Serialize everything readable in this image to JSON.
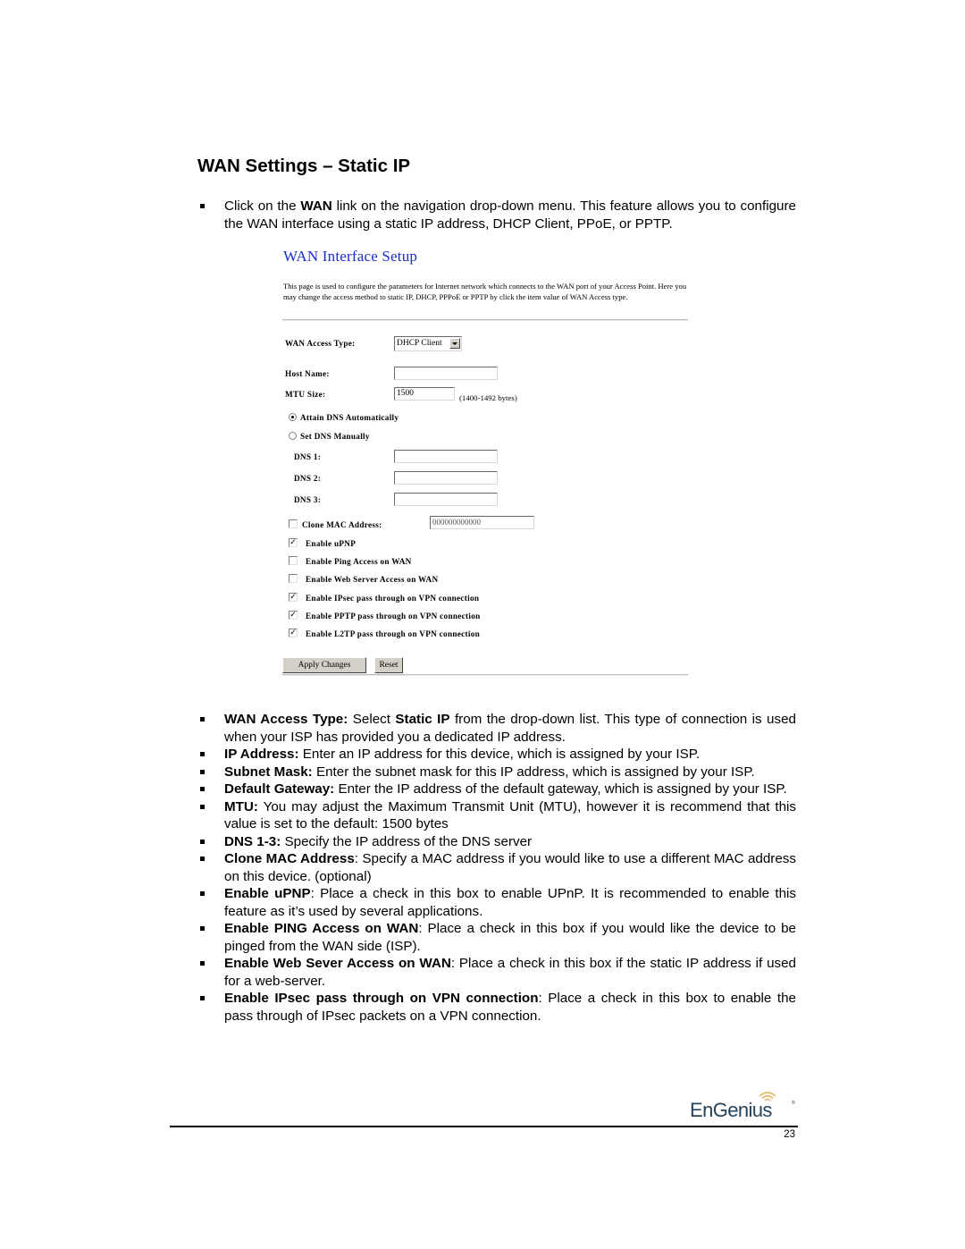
{
  "page": {
    "title": "WAN Settings – Static IP",
    "intro": [
      {
        "pre": "Click on the ",
        "bold": "WAN",
        "post": " link on the navigation drop-down menu. This feature allows you to configure the WAN interface using a static IP address, DHCP Client, PPoE, or PPTP."
      }
    ],
    "page_number": "23",
    "logo_text": "EnGenius",
    "logo_mark": "®"
  },
  "screenshot": {
    "title": "WAN Interface Setup",
    "description": "This page is used to configure the parameters for Internet network which connects to the WAN port of your Access Point. Here you may change the access method to static IP, DHCP, PPPoE or PPTP by click the item value of WAN Access type.",
    "wan_access_type": {
      "label": "WAN Access Type:",
      "value": "DHCP Client"
    },
    "host_name": {
      "label": "Host Name:",
      "value": ""
    },
    "mtu_size": {
      "label": "MTU Size:",
      "value": "1500",
      "hint": "(1400-1492 bytes)"
    },
    "dns_mode": [
      {
        "label": "Attain DNS Automatically",
        "selected": true
      },
      {
        "label": "Set DNS Manually",
        "selected": false
      }
    ],
    "dns": [
      {
        "label": "DNS 1:",
        "value": ""
      },
      {
        "label": "DNS 2:",
        "value": ""
      },
      {
        "label": "DNS 3:",
        "value": ""
      }
    ],
    "clone_mac": {
      "label": "Clone MAC Address:",
      "value": "000000000000",
      "checked": false
    },
    "options": [
      {
        "label": "Enable uPNP",
        "checked": true
      },
      {
        "label": "Enable Ping Access on WAN",
        "checked": false
      },
      {
        "label": "Enable Web Server Access on WAN",
        "checked": false
      },
      {
        "label": "Enable IPsec pass through on VPN connection",
        "checked": true
      },
      {
        "label": "Enable PPTP pass through on VPN connection",
        "checked": true
      },
      {
        "label": "Enable L2TP pass through on VPN connection",
        "checked": true
      }
    ],
    "buttons": {
      "apply": "Apply Changes",
      "reset": "Reset"
    }
  },
  "descriptions": [
    {
      "bold": "WAN Access Type:",
      "text": " Select ",
      "bold2": "Static IP",
      "text2": " from the drop-down list. This type of connection is used when your ISP has provided you a dedicated IP address."
    },
    {
      "bold": "IP Address:",
      "text": " Enter an IP address for this device, which is assigned by your ISP."
    },
    {
      "bold": "Subnet Mask:",
      "text": " Enter the subnet mask for this IP address, which is assigned by your ISP."
    },
    {
      "bold": "Default Gateway:",
      "text": " Enter the IP address of the default gateway, which is assigned by your ISP."
    },
    {
      "bold": "MTU:",
      "text": " You may adjust the Maximum Transmit Unit (MTU), however it is recommend that this value is set to the default: 1500 bytes"
    },
    {
      "bold": "DNS 1-3:",
      "text": " Specify the IP address of the DNS server"
    },
    {
      "bold": "Clone MAC Address",
      "text": ": Specify a MAC address if you would like to use a different MAC address on this device. (optional)"
    },
    {
      "bold": "Enable uPNP",
      "text": ": Place a check in this box to enable UPnP. It is recommended to enable this feature as it’s used by several applications."
    },
    {
      "bold": "Enable PING Access on WAN",
      "text": ": Place a check in this box if you would like the device to be pinged from the WAN side (ISP)."
    },
    {
      "bold": "Enable Web Sever Access on WAN",
      "text": ": Place a check in this box if the static IP address if used for a web-server."
    },
    {
      "bold": "Enable IPsec pass through on VPN connection",
      "text": ": Place a check in this box to enable the pass through of IPsec packets on a VPN connection."
    }
  ]
}
